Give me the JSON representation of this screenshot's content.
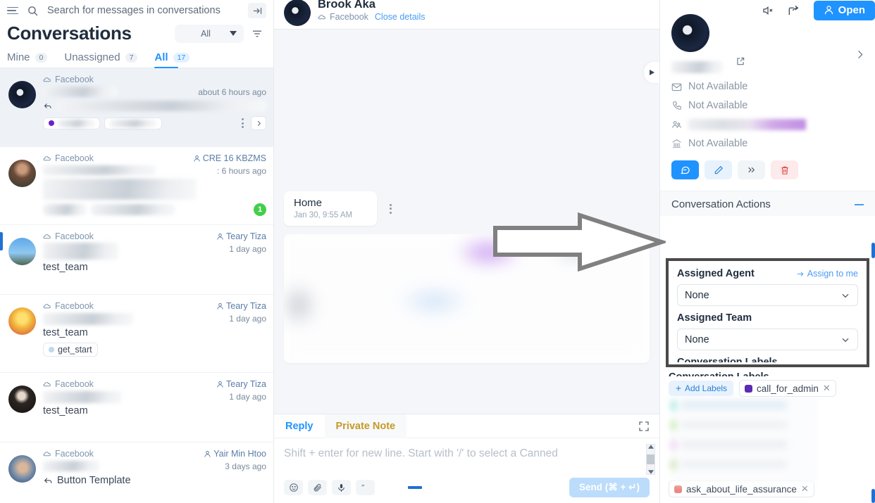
{
  "search": {
    "placeholder": "Search for messages in conversations",
    "menu_icon": "hamburger-icon",
    "icon": "search-icon",
    "collapse_icon": "collapse-panel-icon"
  },
  "conversations": {
    "title": "Conversations",
    "filter_value": "All",
    "sort_icon": "sort-filter-icon",
    "tabs": [
      {
        "label": "Mine",
        "count": "0",
        "active": false
      },
      {
        "label": "Unassigned",
        "count": "7",
        "active": false
      },
      {
        "label": "All",
        "count": "17",
        "active": true
      }
    ],
    "items": [
      {
        "channel": "Facebook",
        "assignee": "",
        "time": "about 6 hours ago",
        "preview": "",
        "team": "",
        "label": "",
        "label_color": "#6b21c8",
        "unread": "",
        "selected": true,
        "redacted": true
      },
      {
        "channel": "Facebook",
        "assignee": "CRE 16 KBZMS",
        "time": ": 6 hours ago",
        "preview": "",
        "team": "",
        "label": "",
        "unread": "1",
        "selected": false,
        "redacted": true
      },
      {
        "channel": "Facebook",
        "assignee": "Teary Tiza",
        "time": "1 day ago",
        "preview": "",
        "team": "test_team",
        "label": "",
        "unread": "",
        "selected": false,
        "redacted": true
      },
      {
        "channel": "Facebook",
        "assignee": "Teary Tiza",
        "time": "1 day ago",
        "preview": "",
        "team": "test_team",
        "label": "get_start",
        "label_color": "#bcd9ee",
        "unread": "",
        "selected": false,
        "redacted": true
      },
      {
        "channel": "Facebook",
        "assignee": "Teary Tiza",
        "time": "1 day ago",
        "preview": "",
        "team": "test_team",
        "label": "",
        "unread": "",
        "selected": false,
        "redacted": true
      },
      {
        "channel": "Facebook",
        "assignee": "Yair Min Htoo",
        "time": "3 days ago",
        "preview": "Button Template",
        "team": "",
        "label": "",
        "unread": "",
        "selected": false,
        "redacted": true
      }
    ]
  },
  "conversation_header": {
    "name": "Brook Aka",
    "channel": "Facebook",
    "close_details": "Close details"
  },
  "top_actions": {
    "mute_icon": "mute-icon",
    "share_icon": "share-icon",
    "open_label": "Open",
    "open_icon": "person-icon"
  },
  "thread": {
    "message_text": "Home",
    "message_time": "Jan 30, 9:55 AM",
    "kebab_icon": "more-options-icon",
    "next_icon": "next-conversation-icon"
  },
  "composer": {
    "tab_reply": "Reply",
    "tab_private_note": "Private Note",
    "expand_icon": "expand-editor-icon",
    "placeholder": "Shift + enter for new line. Start with '/' to select a Canned",
    "send_label": "Send (⌘ + ↵)",
    "icons": [
      "emoji-icon",
      "attachment-icon",
      "microphone-icon",
      "canned-response-icon"
    ]
  },
  "contact": {
    "email": "Not Available",
    "phone": "Not Available",
    "social": "",
    "company": "Not Available",
    "external_icon": "open-external-icon",
    "expand_icon": "expand-contact-icon",
    "actions": [
      "message-icon",
      "edit-icon",
      "merge-icon",
      "delete-icon"
    ]
  },
  "conversation_actions": {
    "title": "Conversation Actions",
    "collapse_icon": "collapse-section-icon",
    "assigned_agent_label": "Assigned Agent",
    "assign_to_me": "Assign to me",
    "assigned_agent_value": "None",
    "assigned_team_label": "Assigned Team",
    "assigned_team_value": "None",
    "labels_section_title": "Conversation Labels"
  },
  "labels": {
    "add_label": "Add Labels",
    "chips": [
      {
        "name": "call_for_admin",
        "color": "#5b2bb5"
      },
      {
        "name": "ask_about_life_assurance",
        "color": "#e98a85"
      }
    ]
  },
  "colors": {
    "accent": "#1f93ff",
    "note": "#c49a27",
    "unread_badge": "#44ce4b",
    "annotation": "#808080"
  }
}
